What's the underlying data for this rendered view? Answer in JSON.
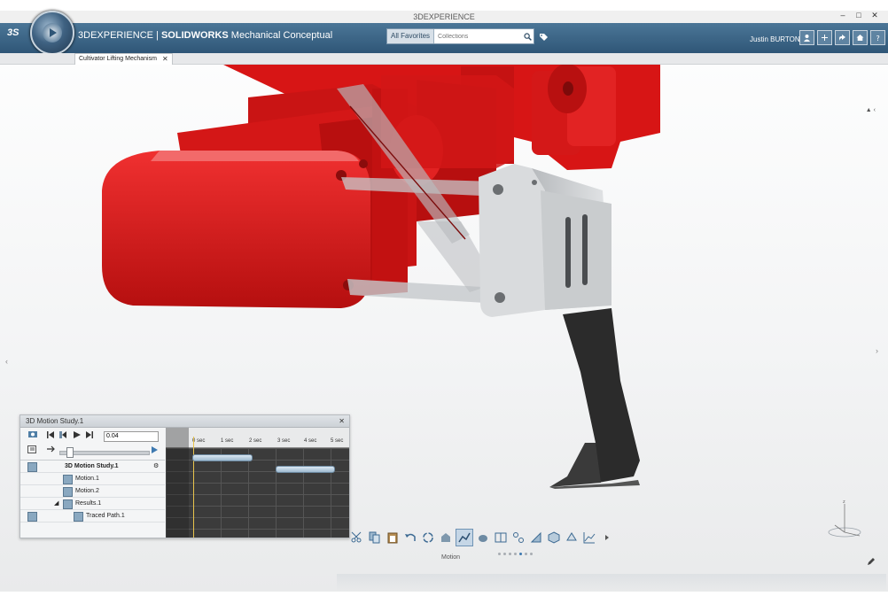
{
  "window": {
    "caption": "3DEXPERIENCE",
    "controls": [
      "–",
      "□",
      "✕"
    ]
  },
  "header": {
    "logo_text": "3S",
    "brand_prefix": "3D",
    "brand_main": "EXPERIENCE",
    "separator": "|",
    "product_bold": "SOLIDWORKS",
    "product_rest": " Mechanical Conceptual",
    "search_scope": "All Favorites",
    "search_placeholder": "Collections",
    "user_name": "Justin BURTON",
    "action_icons": [
      "user-icon",
      "add-icon",
      "share-icon",
      "home-icon",
      "help-icon"
    ]
  },
  "tabs": [
    {
      "label": "Cultivator Lifting Mechanism",
      "close": "✕"
    }
  ],
  "tab_right_text": "▲ ‹",
  "motion_study": {
    "title": "3D Motion Study.1",
    "close": "✕",
    "time_value": "0.04",
    "tree": [
      {
        "label": "3D Motion Study.1",
        "level": 0,
        "bold": true
      },
      {
        "label": "Motion.1",
        "level": 1
      },
      {
        "label": "Motion.2",
        "level": 1
      },
      {
        "label": "Results.1",
        "level": 1
      },
      {
        "label": "Traced Path.1",
        "level": 2
      }
    ],
    "ruler_ticks": [
      "0 sec",
      "1 sec",
      "2 sec",
      "3 sec",
      "4 sec",
      "5 sec"
    ],
    "motion_1": {
      "start_sec": 0.0,
      "end_sec": 2.1
    },
    "motion_2": {
      "start_sec": 3.0,
      "end_sec": 5.1
    },
    "playhead_sec": 0.04
  },
  "toolbar": {
    "label": "Motion",
    "icons": [
      "scissors-icon",
      "copy-icon",
      "paste-icon",
      "undo-icon",
      "rotate-icon",
      "assembly-icon",
      "motion-icon",
      "results-icon",
      "split-icon",
      "select-icon",
      "sketch-icon",
      "cube-icon",
      "section-icon",
      "graph-icon",
      "more-icon"
    ],
    "page_count": 7,
    "active_page": 5
  },
  "colors": {
    "titlebar": "#3a6282",
    "part_red": "#e01b1b",
    "part_gray": "#8e9296",
    "shank": "#2b2b2b"
  }
}
